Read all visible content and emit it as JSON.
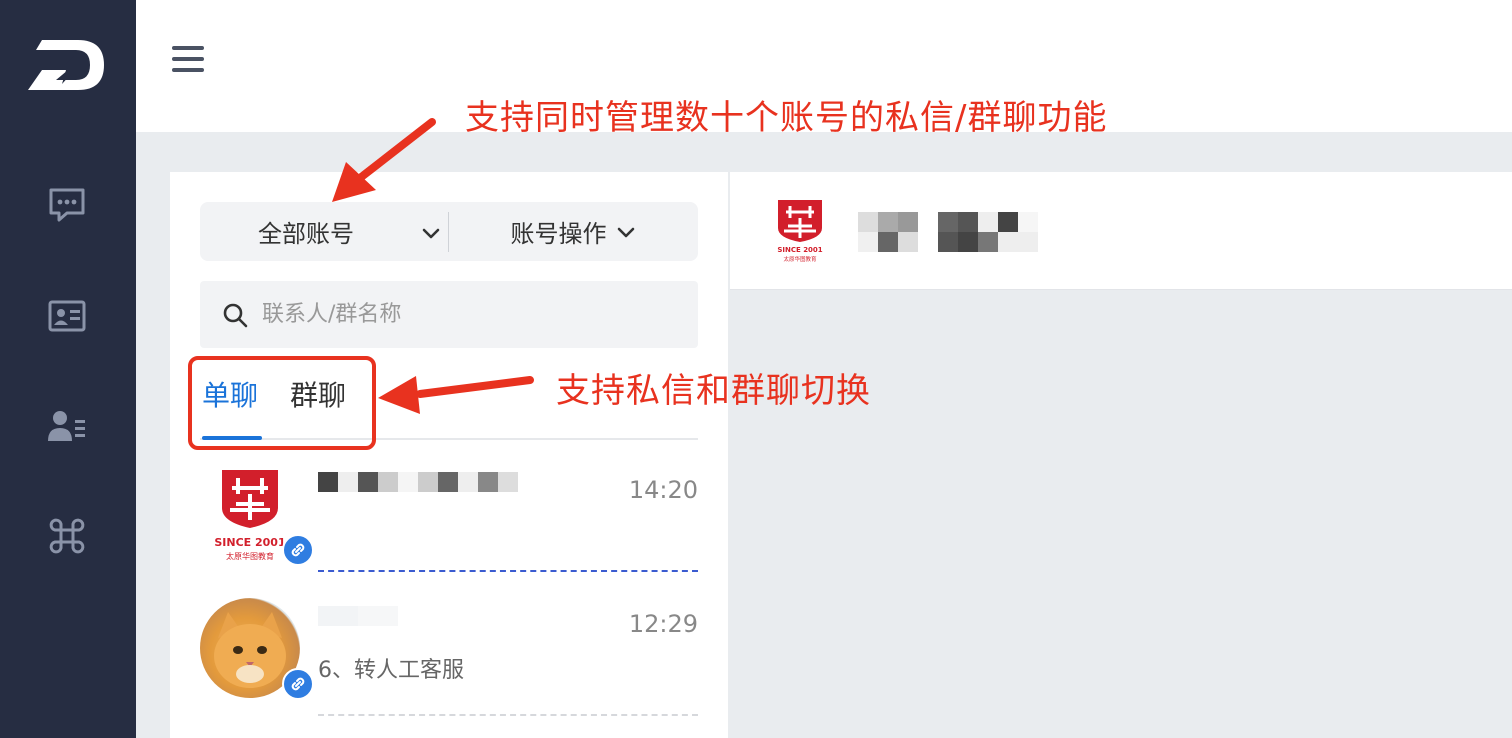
{
  "sidebar": {
    "logo": "D",
    "items": [
      {
        "icon": "chat-bubble-icon"
      },
      {
        "icon": "contact-card-icon"
      },
      {
        "icon": "user-list-icon"
      },
      {
        "icon": "command-icon"
      }
    ]
  },
  "header": {
    "menu_icon": "hamburger-icon"
  },
  "account_bar": {
    "all_accounts_label": "全部账号",
    "account_ops_label": "账号操作"
  },
  "search": {
    "placeholder": "联系人/群名称",
    "value": ""
  },
  "tabs": [
    {
      "label": "单聊",
      "active": true
    },
    {
      "label": "群聊",
      "active": false
    }
  ],
  "conversations": [
    {
      "time": "14:20",
      "preview": "",
      "avatar_text_1": "SINCE 2001",
      "avatar_text_2": "太原华图教育"
    },
    {
      "time": "12:29",
      "preview": "6、转人工客服"
    }
  ],
  "chat_header": {
    "avatar_text_1": "SINCE 2001",
    "avatar_text_2": "太原华图教育"
  },
  "annotations": {
    "top": "支持同时管理数十个账号的私信/群聊功能",
    "middle": "支持私信和群聊切换"
  },
  "colors": {
    "accent": "#1a73d9",
    "annotation": "#e8321f",
    "sidebar": "#262d42"
  }
}
